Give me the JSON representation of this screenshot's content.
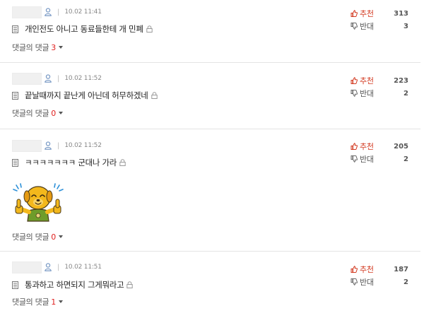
{
  "comments": [
    {
      "time": "10.02 11:41",
      "text": "개인전도 아니고 동료들한테 개 민폐",
      "upvote_label": "추천",
      "upvotes": "313",
      "downvote_label": "반대",
      "downvotes": "3",
      "reply_label": "댓글의 댓글",
      "reply_count": "3",
      "has_sticker": false
    },
    {
      "time": "10.02 11:52",
      "text": "끝날때까지 끝난게 아닌데 허무하겠네",
      "upvote_label": "추천",
      "upvotes": "223",
      "downvote_label": "반대",
      "downvotes": "2",
      "reply_label": "댓글의 댓글",
      "reply_count": "0",
      "has_sticker": false
    },
    {
      "time": "10.02 11:52",
      "text": "ㅋㅋㅋㅋㅋㅋㅋ 군대나 가라",
      "upvote_label": "추천",
      "upvotes": "205",
      "downvote_label": "반대",
      "downvotes": "2",
      "reply_label": "댓글의 댓글",
      "reply_count": "0",
      "has_sticker": true
    },
    {
      "time": "10.02 11:51",
      "text": "통과하고 하면되지 그게뭐라고",
      "upvote_label": "추천",
      "upvotes": "187",
      "downvote_label": "반대",
      "downvotes": "2",
      "reply_label": "댓글의 댓글",
      "reply_count": "1",
      "has_sticker": false
    }
  ],
  "icons": {
    "user": "user-icon",
    "document": "document-icon",
    "lock": "lock-icon",
    "upvote": "thumbs-up-icon",
    "downvote": "thumbs-down-icon",
    "caret": "caret-down-icon",
    "sticker": "thumbs-up-sticker"
  },
  "colors": {
    "upvote_label": "#d2381f",
    "reply_count": "#e0201f",
    "divider": "#e4e4e4"
  }
}
